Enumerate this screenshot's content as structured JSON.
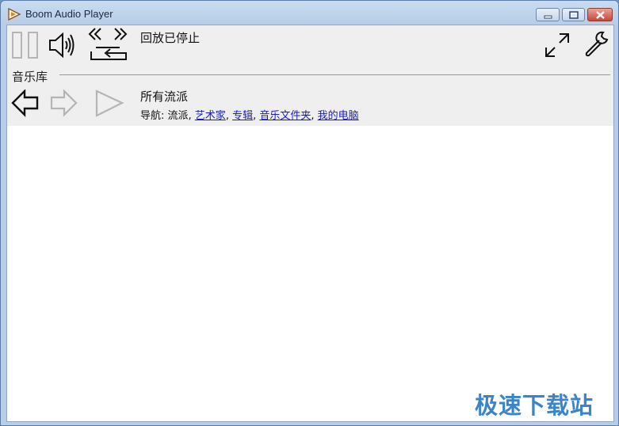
{
  "window": {
    "title": "Boom Audio Player"
  },
  "player": {
    "status": "回放已停止"
  },
  "library": {
    "section_label": "音乐库",
    "current_title": "所有流派",
    "nav_prefix": "导航: ",
    "nav_current": "流派",
    "nav_links": [
      "艺术家",
      "专辑",
      "音乐文件夹",
      "我的电脑"
    ],
    "separator": ", "
  },
  "watermark": "极速下载站",
  "icons": {
    "app": "play-triangle-icon",
    "pause": "pause-icon",
    "volume": "speaker-icon",
    "skip": "rewind-forward-icon",
    "repeat": "repeat-icon",
    "fullscreen": "expand-icon",
    "settings": "wrench-icon",
    "back": "back-arrow-icon",
    "forward": "forward-arrow-icon",
    "play": "play-icon"
  },
  "colors": {
    "link": "#1a1acc",
    "toolbar_bg": "#efefef",
    "watermark": "#3c84c9"
  }
}
